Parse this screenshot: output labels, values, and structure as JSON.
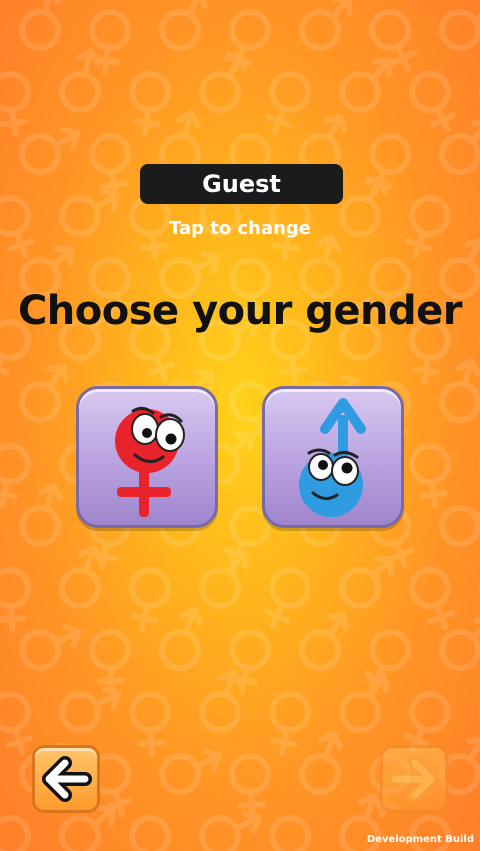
{
  "profile": {
    "name": "Guest",
    "hint": "Tap to change"
  },
  "screen": {
    "title": "Choose your gender"
  },
  "options": [
    {
      "id": "female",
      "icon": "female-character-icon"
    },
    {
      "id": "male",
      "icon": "male-character-icon"
    }
  ],
  "nav": {
    "back_icon": "back-arrow-icon",
    "next_icon": "forward-arrow-icon"
  },
  "footer": {
    "build_label": "Development Build"
  },
  "colors": {
    "background_center": "#ffd21a",
    "background_edge": "#ff7e2a",
    "female": "#e8232b",
    "male": "#2f9be0",
    "button_purple": "#b9a2e0"
  }
}
